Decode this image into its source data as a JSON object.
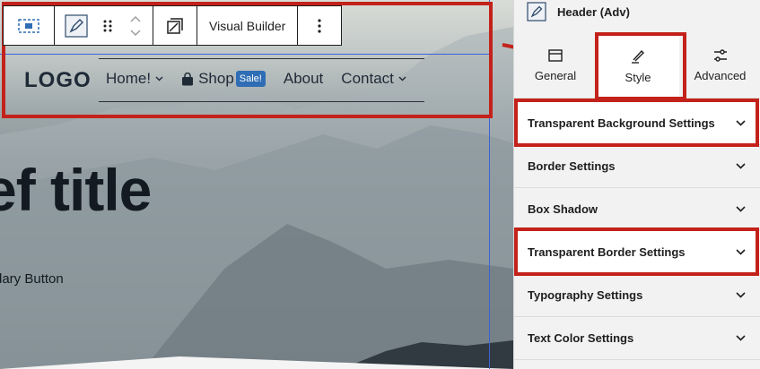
{
  "toolbar": {
    "visual_builder_label": "Visual Builder"
  },
  "header": {
    "logo_text": "LOGO",
    "nav": [
      {
        "label": "Home!",
        "has_dropdown": true
      },
      {
        "label": "Shop",
        "badge": "Sale!",
        "icon": "shopping-bag-icon"
      },
      {
        "label": "About"
      },
      {
        "label": "Contact",
        "has_dropdown": true
      }
    ]
  },
  "hero": {
    "title_fragment": "ef title",
    "button_fragment": "dary Button"
  },
  "sidebar": {
    "block_title": "Header (Adv)",
    "tabs": [
      {
        "label": "General",
        "icon": "general-icon",
        "active": false
      },
      {
        "label": "Style",
        "icon": "brush-icon",
        "active": true
      },
      {
        "label": "Advanced",
        "icon": "sliders-icon",
        "active": false
      }
    ],
    "panels": [
      {
        "label": "Transparent Background Settings",
        "highlighted": true
      },
      {
        "label": "Border Settings",
        "highlighted": false
      },
      {
        "label": "Box Shadow",
        "highlighted": false
      },
      {
        "label": "Transparent Border Settings",
        "highlighted": true
      },
      {
        "label": "Typography Settings",
        "highlighted": false
      },
      {
        "label": "Text Color Settings",
        "highlighted": false
      }
    ]
  },
  "colors": {
    "annotation_red": "#c3221b",
    "selection_blue": "#3d62d8",
    "badge_blue": "#2f6db5"
  }
}
